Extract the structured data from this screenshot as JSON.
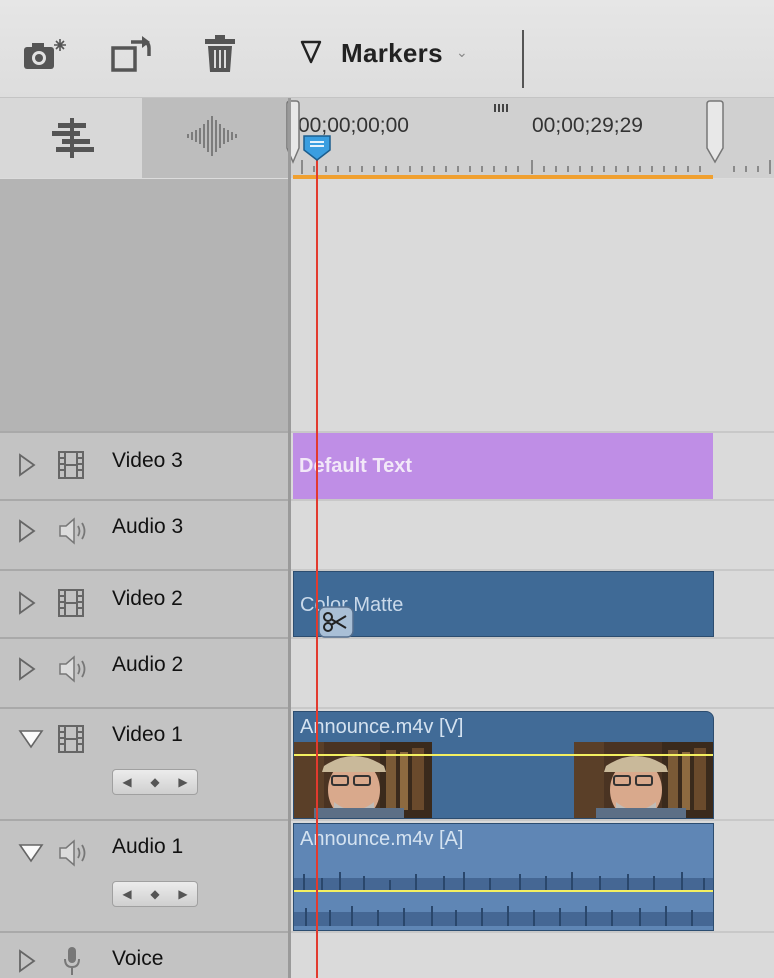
{
  "toolbar": {
    "icons": [
      "camera-icon",
      "export-frame-icon",
      "trash-icon"
    ],
    "markers_label": "Markers",
    "markers_dropdown_icon": "chevron-down-icon"
  },
  "header": {
    "timecode_start": "00;00;00;00",
    "timecode_mid": "00;00;29;29"
  },
  "tracks": [
    {
      "name": "Video 3",
      "type": "video",
      "expanded": false
    },
    {
      "name": "Audio 3",
      "type": "audio",
      "expanded": false
    },
    {
      "name": "Video 2",
      "type": "video",
      "expanded": false
    },
    {
      "name": "Audio 2",
      "type": "audio",
      "expanded": false
    },
    {
      "name": "Video 1",
      "type": "video",
      "expanded": true
    },
    {
      "name": "Audio 1",
      "type": "audio",
      "expanded": true
    },
    {
      "name": "Voice",
      "type": "voice",
      "expanded": false
    }
  ],
  "clips": {
    "video3": "Default Text",
    "video2": "Color Matte",
    "video1": "Announce.m4v [V]",
    "audio1": "Announce.m4v [A]"
  },
  "colors": {
    "text_clip": "#bf8ee6",
    "matte_clip": "#3f6a96",
    "video_clip": "#416b97",
    "audio_clip": "#5f86b5",
    "playhead": "#e23a2e",
    "work_area": "#f0a030",
    "volume_line": "#f4f060"
  }
}
